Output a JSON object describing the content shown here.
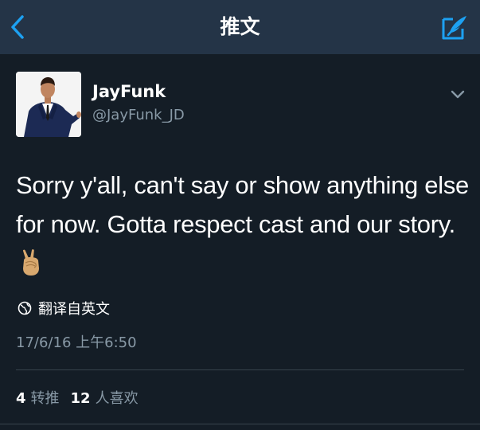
{
  "nav": {
    "title": "推文",
    "back_icon": "chevron-left-icon",
    "compose_icon": "compose-tweet-icon"
  },
  "tweet": {
    "display_name": "JayFunk",
    "handle": "@JayFunk_JD",
    "text": "Sorry y'all, can't say or show anything else for now. Gotta respect cast and our story.",
    "emoji": "victory-hand-emoji",
    "translate_label": "翻译自英文",
    "timestamp": "17/6/16 上午6:50"
  },
  "stats": {
    "retweets_count": "4",
    "retweets_label": "转推",
    "likes_count": "12",
    "likes_label": "人喜欢"
  },
  "colors": {
    "background": "#141d26",
    "nav_bar": "#243447",
    "accent": "#1da1f2",
    "secondary_text": "#8899a6"
  }
}
